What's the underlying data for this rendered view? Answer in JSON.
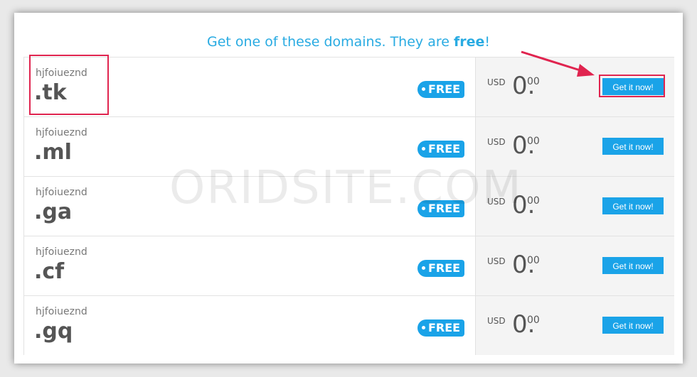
{
  "headline": {
    "text": "Get one of these domains. They are ",
    "bold": "free",
    "end": "!"
  },
  "watermark": "ORIDSITE.COM",
  "colors": {
    "accent": "#1aa3e8",
    "headline": "#29abe2",
    "highlight": "#e0244f"
  },
  "rows": [
    {
      "name": "hjfoiueznd",
      "tld": ".tk",
      "badge": "FREE",
      "currency": "USD",
      "amount": "0.",
      "cents": "00",
      "button": "Get it now!"
    },
    {
      "name": "hjfoiueznd",
      "tld": ".ml",
      "badge": "FREE",
      "currency": "USD",
      "amount": "0.",
      "cents": "00",
      "button": "Get it now!"
    },
    {
      "name": "hjfoiueznd",
      "tld": ".ga",
      "badge": "FREE",
      "currency": "USD",
      "amount": "0.",
      "cents": "00",
      "button": "Get it now!"
    },
    {
      "name": "hjfoiueznd",
      "tld": ".cf",
      "badge": "FREE",
      "currency": "USD",
      "amount": "0.",
      "cents": "00",
      "button": "Get it now!"
    },
    {
      "name": "hjfoiueznd",
      "tld": ".gq",
      "badge": "FREE",
      "currency": "USD",
      "amount": "0.",
      "cents": "00",
      "button": "Get it now!"
    }
  ]
}
